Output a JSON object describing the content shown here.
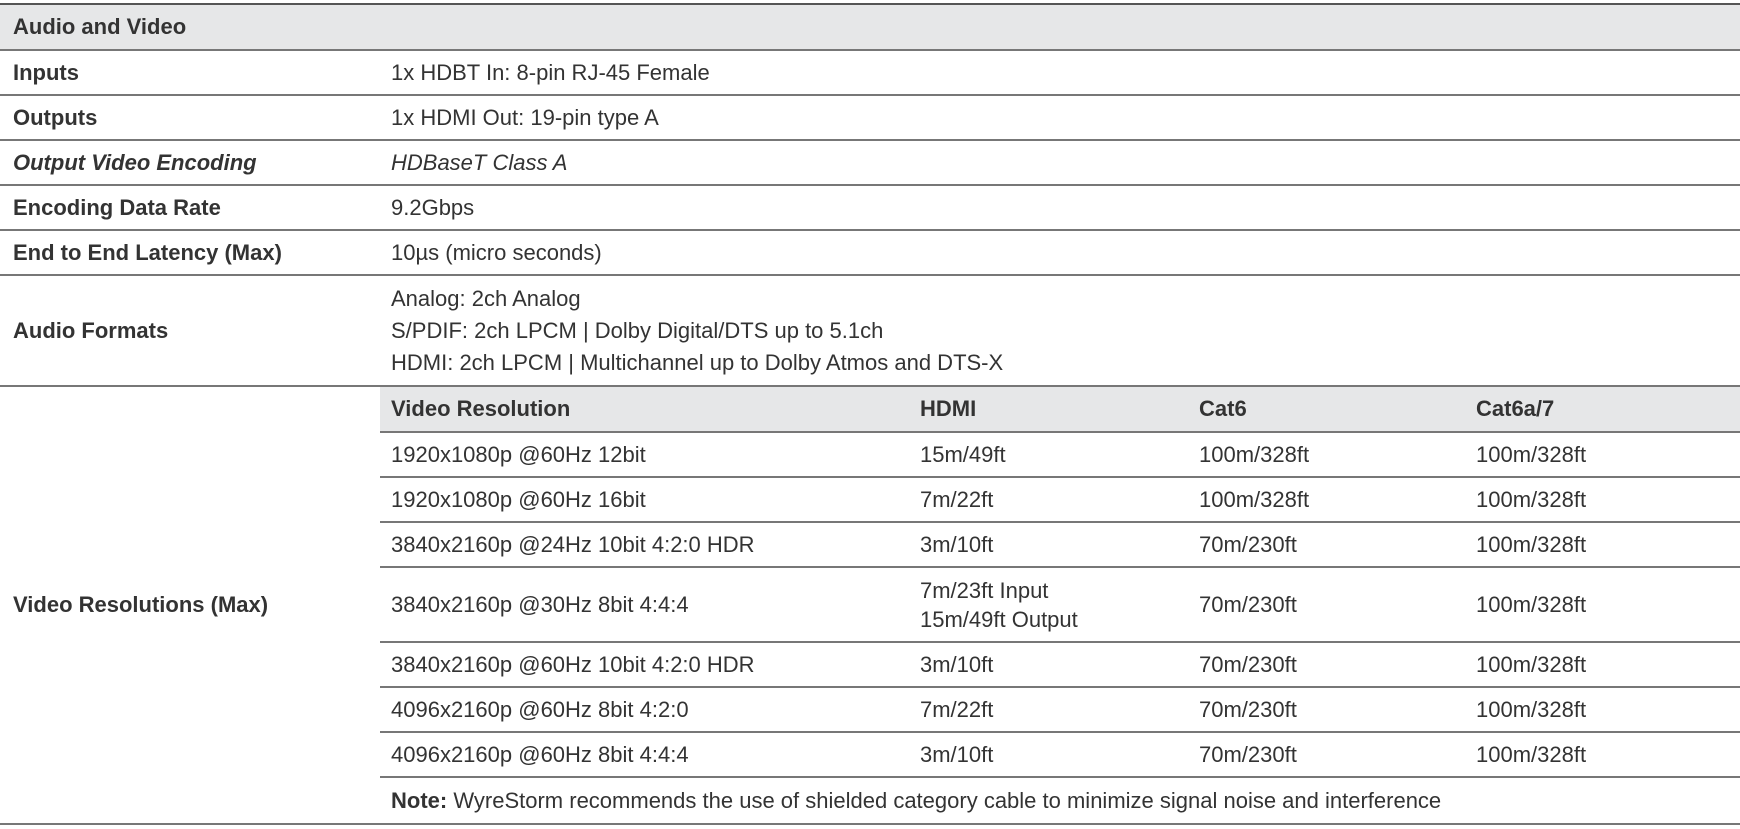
{
  "section_title": "Audio and Video",
  "rows": [
    {
      "label": "Inputs",
      "value": "1x HDBT In: 8-pin RJ-45 Female"
    },
    {
      "label": "Outputs",
      "value": "1x HDMI Out: 19-pin type A"
    },
    {
      "label": "Output Video Encoding",
      "value": "HDBaseT Class A"
    },
    {
      "label": "Encoding Data Rate",
      "value": "9.2Gbps"
    },
    {
      "label": "End to End Latency (Max)",
      "value": "10µs (micro seconds)"
    }
  ],
  "audio": {
    "label": "Audio Formats",
    "lines": [
      "Analog: 2ch Analog",
      "S/PDIF: 2ch LPCM | Dolby Digital/DTS up to 5.1ch",
      "HDMI: 2ch LPCM | Multichannel up to Dolby Atmos and DTS-X"
    ]
  },
  "video": {
    "label": "Video Resolutions (Max)",
    "headers": [
      "Video Resolution",
      "HDMI",
      "Cat6",
      "Cat6a/7"
    ],
    "rows": [
      [
        "1920x1080p @60Hz 12bit",
        "15m/49ft",
        "100m/328ft",
        "100m/328ft"
      ],
      [
        "1920x1080p @60Hz 16bit",
        "7m/22ft",
        "100m/328ft",
        "100m/328ft"
      ],
      [
        "3840x2160p @24Hz 10bit 4:2:0 HDR",
        "3m/10ft",
        "70m/230ft",
        "100m/328ft"
      ],
      [
        "3840x2160p @30Hz 8bit 4:4:4",
        "7m/23ft Input",
        "70m/230ft",
        "100m/328ft"
      ],
      [
        "3840x2160p @60Hz 10bit 4:2:0 HDR",
        "3m/10ft",
        "70m/230ft",
        "100m/328ft"
      ],
      [
        "4096x2160p @60Hz 8bit 4:2:0",
        "7m/22ft",
        "70m/230ft",
        "100m/328ft"
      ],
      [
        "4096x2160p @60Hz 8bit 4:4:4",
        "3m/10ft",
        "70m/230ft",
        "100m/328ft"
      ]
    ],
    "row4_hdmi_line2": "15m/49ft Output",
    "note_label": "Note:",
    "note_text": " WyreStorm recommends the use of shielded category cable to minimize signal noise and interference"
  }
}
